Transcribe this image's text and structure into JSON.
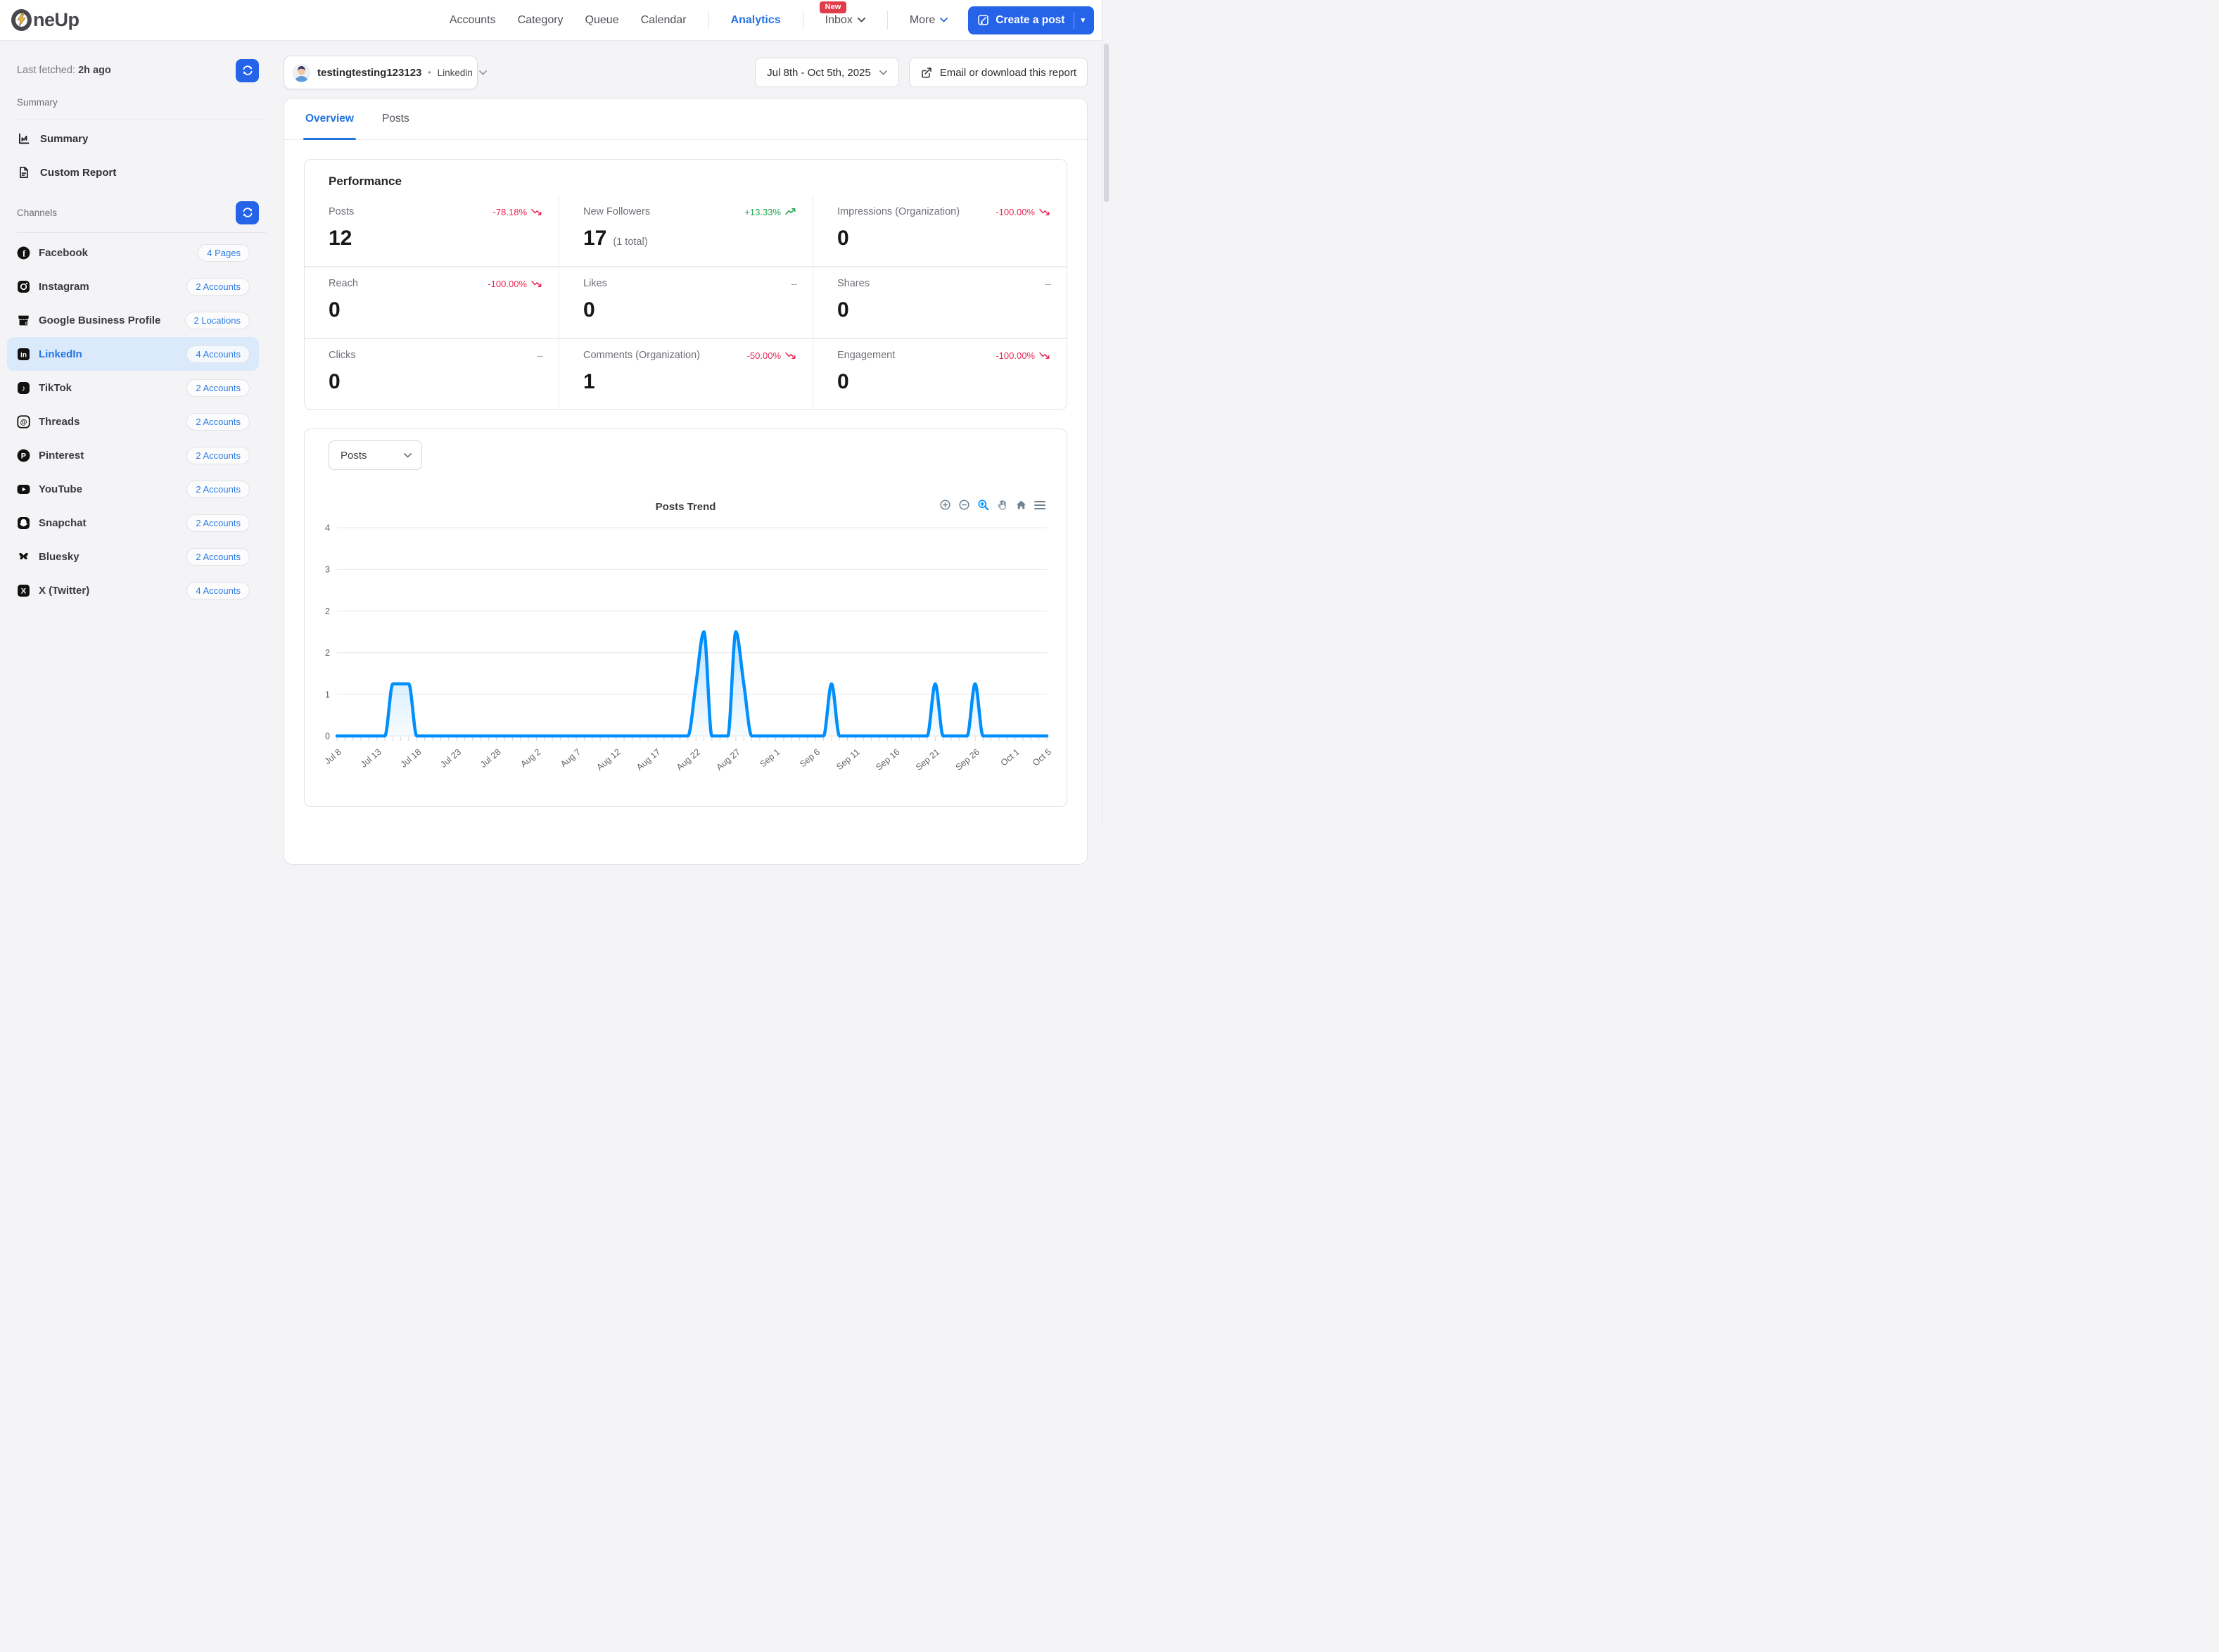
{
  "nav": {
    "logo_rest": "neUp",
    "items": [
      {
        "label": "Accounts"
      },
      {
        "label": "Category"
      },
      {
        "label": "Queue"
      },
      {
        "label": "Calendar"
      },
      {
        "label": "Analytics",
        "active": true,
        "sep_before": true
      },
      {
        "label": "Inbox",
        "chevron": true,
        "badge": "New",
        "sep_before": true
      },
      {
        "label": "More",
        "chevron": true,
        "chevron_blue": true,
        "sep_before": true
      }
    ],
    "create_post_label": "Create a post"
  },
  "sidebar": {
    "last_fetched_label": "Last fetched:",
    "last_fetched_value": "2h ago",
    "summary_header": "Summary",
    "summary_items": [
      {
        "label": "Summary",
        "icon": "chart"
      },
      {
        "label": "Custom Report",
        "icon": "document"
      }
    ],
    "channels_header": "Channels",
    "channels": [
      {
        "name": "Facebook",
        "badge": "4 Pages",
        "icon": "facebook"
      },
      {
        "name": "Instagram",
        "badge": "2 Accounts",
        "icon": "instagram"
      },
      {
        "name": "Google Business Profile",
        "badge": "2 Locations",
        "icon": "gbp"
      },
      {
        "name": "LinkedIn",
        "badge": "4 Accounts",
        "icon": "linkedin",
        "selected": true
      },
      {
        "name": "TikTok",
        "badge": "2 Accounts",
        "icon": "tiktok"
      },
      {
        "name": "Threads",
        "badge": "2 Accounts",
        "icon": "threads"
      },
      {
        "name": "Pinterest",
        "badge": "2 Accounts",
        "icon": "pinterest"
      },
      {
        "name": "YouTube",
        "badge": "2 Accounts",
        "icon": "youtube"
      },
      {
        "name": "Snapchat",
        "badge": "2 Accounts",
        "icon": "snapchat"
      },
      {
        "name": "Bluesky",
        "badge": "2 Accounts",
        "icon": "bluesky"
      },
      {
        "name": "X (Twitter)",
        "badge": "4 Accounts",
        "icon": "x"
      }
    ]
  },
  "header": {
    "account_name": "testingtesting123123",
    "separator": "•",
    "account_network": "Linkedin",
    "date_range": "Jul 8th - Oct 5th, 2025",
    "export_label": "Email or download this report"
  },
  "tabs": [
    {
      "label": "Overview",
      "active": true
    },
    {
      "label": "Posts"
    }
  ],
  "performance": {
    "title": "Performance",
    "metrics": [
      {
        "label": "Posts",
        "value": "12",
        "change": "-78.18%",
        "direction": "down"
      },
      {
        "label": "New Followers",
        "value": "17",
        "suffix": "(1 total)",
        "change": "+13.33%",
        "direction": "up"
      },
      {
        "label": "Impressions (Organization)",
        "value": "0",
        "change": "-100.00%",
        "direction": "down"
      },
      {
        "label": "Reach",
        "value": "0",
        "change": "-100.00%",
        "direction": "down"
      },
      {
        "label": "Likes",
        "value": "0",
        "change": "--"
      },
      {
        "label": "Shares",
        "value": "0",
        "change": "--"
      },
      {
        "label": "Clicks",
        "value": "0",
        "change": "--"
      },
      {
        "label": "Comments (Organization)",
        "value": "1",
        "change": "-50.00%",
        "direction": "down"
      },
      {
        "label": "Engagement",
        "value": "0",
        "change": "-100.00%",
        "direction": "down"
      }
    ]
  },
  "chart_section": {
    "metric_selector": "Posts",
    "title": "Posts Trend",
    "toolbar": [
      "zoom-in",
      "zoom-out",
      "selection-zoom",
      "pan",
      "home",
      "menu"
    ]
  },
  "chart_data": {
    "type": "area",
    "title": "Posts Trend",
    "x_start": "Jul 8",
    "x_end": "Oct 5",
    "x_tick_labels": [
      "Jul 8",
      "Jul 13",
      "Jul 18",
      "Jul 23",
      "Jul 28",
      "Aug 2",
      "Aug 7",
      "Aug 12",
      "Aug 17",
      "Aug 22",
      "Aug 27",
      "Sep 1",
      "Sep 6",
      "Sep 11",
      "Sep 16",
      "Sep 21",
      "Sep 26",
      "Oct 1",
      "Oct 5"
    ],
    "x_tick_indices": [
      0,
      5,
      10,
      15,
      20,
      25,
      30,
      35,
      40,
      45,
      50,
      55,
      60,
      65,
      70,
      75,
      80,
      85,
      89
    ],
    "daily_values": [
      0,
      0,
      0,
      0,
      0,
      0,
      0,
      1,
      1,
      1,
      0,
      0,
      0,
      0,
      0,
      0,
      0,
      0,
      0,
      0,
      0,
      0,
      0,
      0,
      0,
      0,
      0,
      0,
      0,
      0,
      0,
      0,
      0,
      0,
      0,
      0,
      0,
      0,
      0,
      0,
      0,
      0,
      0,
      0,
      0,
      1,
      2,
      0,
      0,
      0,
      2,
      1,
      0,
      0,
      0,
      0,
      0,
      0,
      0,
      0,
      0,
      0,
      1,
      0,
      0,
      0,
      0,
      0,
      0,
      0,
      0,
      0,
      0,
      0,
      0,
      1,
      0,
      0,
      0,
      0,
      1,
      0,
      0,
      0,
      0,
      0,
      0,
      0,
      0,
      0
    ],
    "y_ticks": [
      {
        "value": 0,
        "label": "0"
      },
      {
        "value": 0.8,
        "label": "1"
      },
      {
        "value": 1.6,
        "label": "2"
      },
      {
        "value": 2.4,
        "label": "2"
      },
      {
        "value": 3.2,
        "label": "3"
      },
      {
        "value": 4,
        "label": "4"
      }
    ],
    "ylim": [
      0,
      4
    ],
    "grid": true,
    "legend": "none",
    "line_color": "#008FFB"
  },
  "colors": {
    "accent": "#2563e8",
    "nav_active": "#2374e1",
    "badge_text": "#2d7be5",
    "selected_bg": "#dbeafb",
    "negative": "#e42855",
    "positive": "#1ca34a",
    "chart_line": "#008FFB"
  }
}
